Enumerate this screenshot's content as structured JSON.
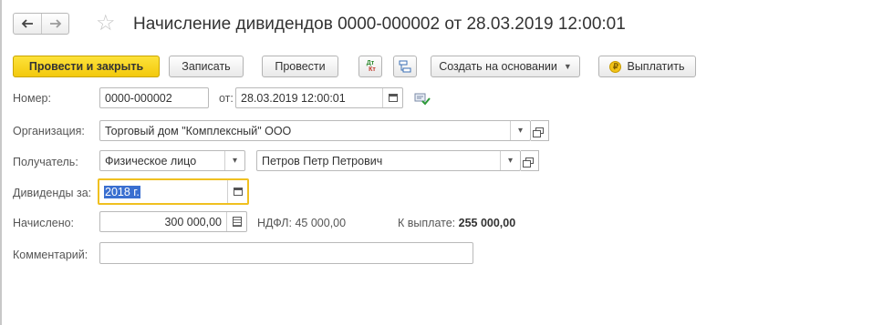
{
  "header": {
    "title": "Начисление дивидендов 0000-000002 от 28.03.2019 12:00:01",
    "back_icon": "arrow-left-icon",
    "forward_icon": "arrow-right-icon",
    "favorite_icon": "star-icon"
  },
  "toolbar": {
    "post_and_close": "Провести и закрыть",
    "save": "Записать",
    "post": "Провести",
    "dtkt_dt": "Дт",
    "dtkt_kt": "Кт",
    "create_based_on": "Создать на основании",
    "pay": "Выплатить",
    "coin_symbol": "₽"
  },
  "form": {
    "number_label": "Номер:",
    "number_value": "0000-000002",
    "date_label": "от:",
    "date_value": "28.03.2019 12:00:01",
    "organization_label": "Организация:",
    "organization_value": "Торговый дом \"Комплексный\" ООО",
    "recipient_label": "Получатель:",
    "recipient_type": "Физическое лицо",
    "recipient_value": "Петров Петр Петрович",
    "period_label": "Дивиденды за:",
    "period_value": "2018 г.",
    "accrued_label": "Начислено:",
    "accrued_value": "300 000,00",
    "ndfl_text": "НДФЛ: 45 000,00",
    "payout_label": "К выплате:",
    "payout_value": "255 000,00",
    "comment_label": "Комментарий:",
    "comment_value": ""
  },
  "colors": {
    "primary_button": "#f3c90d",
    "focus_border": "#f0c020",
    "selection": "#3a6fd0"
  }
}
